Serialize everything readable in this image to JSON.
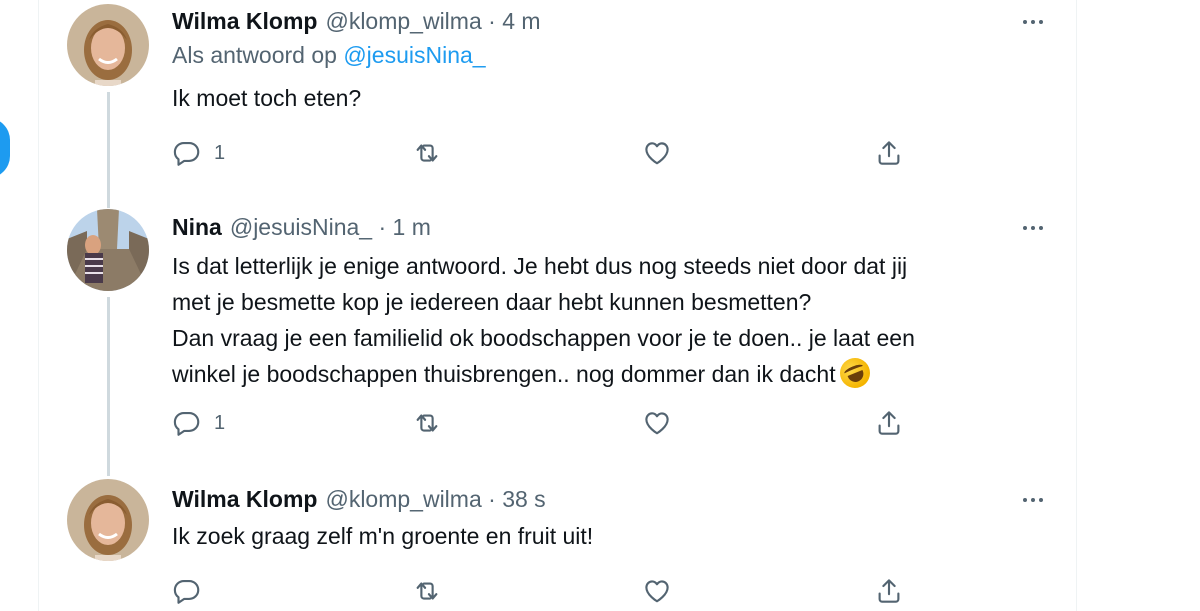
{
  "tweets": [
    {
      "name": "Wilma Klomp",
      "handle": "@klomp_wilma",
      "time": "4 m",
      "reply_prefix": "Als antwoord op",
      "reply_mention": "@jesuisNina_",
      "text": "Ik moet toch eten?",
      "reply_count": "1"
    },
    {
      "name": "Nina",
      "handle": "@jesuisNina_",
      "time": "1 m",
      "text": "Is dat letterlijk je enige antwoord. Je hebt dus nog steeds niet door dat jij\nmet je besmette kop je iedereen daar hebt kunnen besmetten?\nDan vraag je een familielid ok boodschappen voor je te doen.. je laat een\nwinkel je boodschappen thuisbrengen.. nog dommer dan ik dacht",
      "reply_count": "1"
    },
    {
      "name": "Wilma Klomp",
      "handle": "@klomp_wilma",
      "time": "38 s",
      "text": "Ik zoek graag zelf m'n groente en fruit uit!",
      "reply_count": ""
    }
  ],
  "separator": " · ",
  "icons": {
    "reply": "reply-icon",
    "retweet": "retweet-icon",
    "like": "heart-icon",
    "share": "share-icon",
    "more": "more-icon",
    "emoji": "rolling-on-floor-laughing-emoji"
  },
  "colors": {
    "accent": "#1d9bf0",
    "text": "#0f1419",
    "secondary": "#536471",
    "border": "#eff3f4",
    "thread": "#cfd9de"
  }
}
